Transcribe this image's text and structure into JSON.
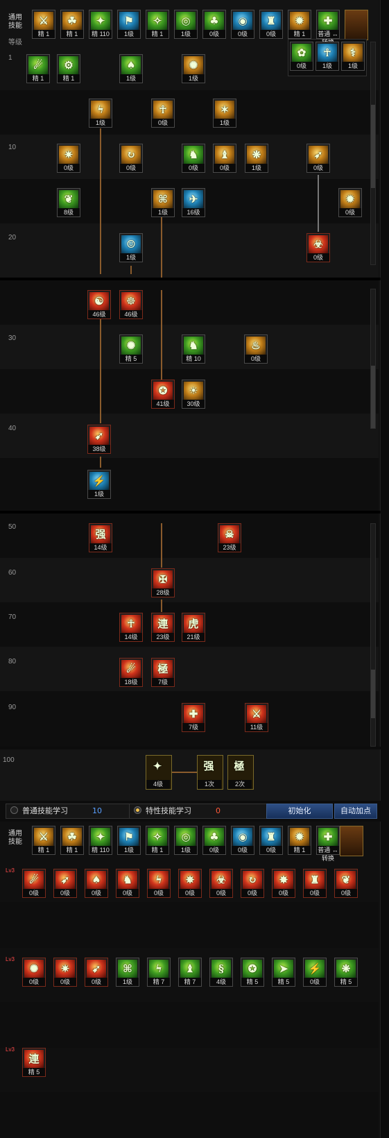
{
  "common_skills_label": "通用技能",
  "level_label": "等级",
  "top_bar": [
    {
      "label": "精 1",
      "color": "gold",
      "g": "⚔"
    },
    {
      "label": "精 1",
      "color": "gold",
      "g": "☘"
    },
    {
      "label": "精 110",
      "color": "green",
      "g": "✦"
    },
    {
      "label": "1级",
      "color": "blue",
      "g": "⚑"
    },
    {
      "label": "精 1",
      "color": "green",
      "g": "✧"
    },
    {
      "label": "1级",
      "color": "green",
      "g": "◎"
    },
    {
      "label": "0级",
      "color": "green",
      "g": "♣"
    },
    {
      "label": "0级",
      "color": "blue",
      "g": "◉"
    },
    {
      "label": "0级",
      "color": "blue",
      "g": "♜"
    },
    {
      "label": "精 1",
      "color": "gold",
      "g": "✹"
    },
    {
      "label": "普通 ↔转换",
      "color": "green",
      "g": "✚"
    }
  ],
  "side_popup": [
    "0级",
    "1级",
    "1级"
  ],
  "levels_a": [
    "1",
    "10",
    "20"
  ],
  "levels_b": [
    "30",
    "40"
  ],
  "levels_c": [
    "50",
    "60",
    "70",
    "80",
    "90"
  ],
  "level_100": "100",
  "tree_a": [
    {
      "label": "精 1",
      "c": "green",
      "g": "☄"
    },
    {
      "label": "精 1",
      "c": "green",
      "g": "⚙"
    },
    {
      "label": "1级",
      "c": "green",
      "g": "♠"
    },
    {
      "label": "1级",
      "c": "gold",
      "g": "✺"
    },
    {
      "label": "1级",
      "c": "gold",
      "g": "ϟ"
    },
    {
      "label": "0级",
      "c": "gold",
      "g": "☥"
    },
    {
      "label": "1级",
      "c": "gold",
      "g": "✶"
    },
    {
      "label": "0级",
      "c": "gold",
      "g": "✷"
    },
    {
      "label": "0级",
      "c": "gold",
      "g": "↻"
    },
    {
      "label": "0级",
      "c": "green",
      "g": "♞"
    },
    {
      "label": "0级",
      "c": "gold",
      "g": "♝"
    },
    {
      "label": "1级",
      "c": "gold",
      "g": "❋"
    },
    {
      "label": "0级",
      "c": "gold",
      "g": "➶"
    },
    {
      "label": "8级",
      "c": "green",
      "g": "❦"
    },
    {
      "label": "1级",
      "c": "gold",
      "g": "⌘"
    },
    {
      "label": "16级",
      "c": "blue",
      "g": "✈"
    },
    {
      "label": "0级",
      "c": "gold",
      "g": "✹"
    },
    {
      "label": "1级",
      "c": "blue",
      "g": "☺"
    },
    {
      "label": "0级",
      "c": "red",
      "g": "☣"
    }
  ],
  "tree_b": [
    {
      "label": "46级",
      "c": "red",
      "g": "☯"
    },
    {
      "label": "46级",
      "c": "red",
      "g": "☸"
    },
    {
      "label": "精 5",
      "c": "green",
      "g": "✺"
    },
    {
      "label": "精 10",
      "c": "green",
      "g": "♞"
    },
    {
      "label": "0级",
      "c": "gold",
      "g": "♨"
    },
    {
      "label": "41级",
      "c": "red",
      "g": "✪"
    },
    {
      "label": "30级",
      "c": "gold",
      "g": "☀"
    },
    {
      "label": "38级",
      "c": "red",
      "g": "➹"
    },
    {
      "label": "1级",
      "c": "blue",
      "g": "⚡"
    }
  ],
  "tree_c": [
    {
      "label": "14级",
      "c": "red",
      "g": "强"
    },
    {
      "label": "23级",
      "c": "red",
      "g": "☠"
    },
    {
      "label": "28级",
      "c": "red",
      "g": "✠"
    },
    {
      "label": "14级",
      "c": "red",
      "g": "☥"
    },
    {
      "label": "23级",
      "c": "red",
      "g": "連"
    },
    {
      "label": "21级",
      "c": "red",
      "g": "虎"
    },
    {
      "label": "18级",
      "c": "red",
      "g": "☄"
    },
    {
      "label": "7级",
      "c": "red",
      "g": "極"
    },
    {
      "label": "7级",
      "c": "red",
      "g": "✚"
    },
    {
      "label": "11级",
      "c": "red",
      "g": "⚔"
    }
  ],
  "awakening": [
    {
      "label": "4级",
      "g": "✦"
    },
    {
      "label": "1次",
      "g": "强"
    },
    {
      "label": "2次",
      "g": "極"
    }
  ],
  "bottom_tabs": {
    "normal": "普通技能学习",
    "normal_points": "10",
    "special": "特性技能学习",
    "special_points": "0",
    "reset": "初始化",
    "auto": "自动加点"
  },
  "bottom_bar": [
    {
      "label": "精 1",
      "color": "gold",
      "g": "⚔"
    },
    {
      "label": "精 1",
      "color": "gold",
      "g": "☘"
    },
    {
      "label": "精 110",
      "color": "green",
      "g": "✦"
    },
    {
      "label": "1级",
      "color": "blue",
      "g": "⚑"
    },
    {
      "label": "精 1",
      "color": "green",
      "g": "✧"
    },
    {
      "label": "1级",
      "color": "green",
      "g": "◎"
    },
    {
      "label": "0级",
      "color": "green",
      "g": "♣"
    },
    {
      "label": "0级",
      "color": "blue",
      "g": "◉"
    },
    {
      "label": "0级",
      "color": "blue",
      "g": "♜"
    },
    {
      "label": "精 1",
      "color": "gold",
      "g": "✹"
    },
    {
      "label": "普通 ↔转换",
      "color": "green",
      "g": "✚"
    }
  ],
  "trait_rows": [
    {
      "tag": "Lv3",
      "items": [
        {
          "label": "0级",
          "g": "☄"
        },
        {
          "label": "0级",
          "g": "➶"
        },
        {
          "label": "0级",
          "g": "♠"
        },
        {
          "label": "0级",
          "g": "♞"
        },
        {
          "label": "0级",
          "g": "ϟ"
        },
        {
          "label": "0级",
          "g": "✵"
        },
        {
          "label": "0级",
          "g": "☣"
        },
        {
          "label": "0级",
          "g": "↻"
        },
        {
          "label": "0级",
          "g": "✸"
        },
        {
          "label": "0级",
          "g": "♜"
        },
        {
          "label": "0级",
          "g": "❦"
        }
      ]
    },
    {
      "tag": "Lv3",
      "items": [
        {
          "label": "0级",
          "g": "✺"
        },
        {
          "label": "0级",
          "g": "✷"
        },
        {
          "label": "0级",
          "g": "➹"
        },
        {
          "label": "1级",
          "g": "⌘"
        },
        {
          "label": "精 7",
          "g": "ϟ"
        },
        {
          "label": "精 7",
          "g": "♝"
        },
        {
          "label": "4级",
          "g": "§"
        },
        {
          "label": "精 5",
          "g": "✪"
        },
        {
          "label": "精 5",
          "g": "➤"
        },
        {
          "label": "0级",
          "g": "⚡"
        },
        {
          "label": "精 5",
          "g": "❋"
        }
      ]
    },
    {
      "tag": "Lv3",
      "items": [
        {
          "label": "精 5",
          "g": "連"
        }
      ]
    }
  ]
}
